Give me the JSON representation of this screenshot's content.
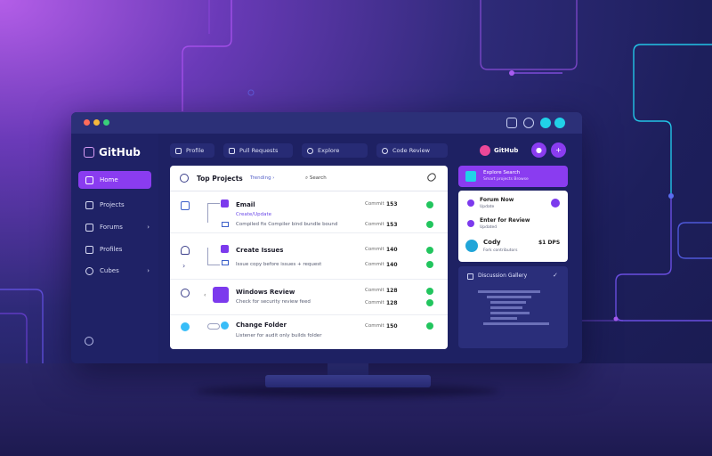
{
  "app": {
    "brand": "GitHub",
    "window_controls": [
      "#ff5f57",
      "#febc2e",
      "#28c840"
    ],
    "titlebar_icons": [
      "grid-icon",
      "clock-icon",
      "cloud-icon"
    ]
  },
  "sidebar": {
    "items": [
      {
        "label": "Home",
        "icon": "phone-icon",
        "active": true
      },
      {
        "label": "Projects",
        "icon": "folder-icon",
        "active": false
      },
      {
        "label": "Forums",
        "icon": "document-icon",
        "active": false,
        "chevron": "›"
      },
      {
        "label": "Profiles",
        "icon": "user-icon",
        "active": false
      },
      {
        "label": "Cubes",
        "icon": "cube-icon",
        "active": false,
        "chevron": "›"
      }
    ],
    "settings_icon": "gear-icon"
  },
  "topbar": {
    "pills": [
      "Profile",
      "Pull Requests",
      "Explore",
      "Code Review"
    ],
    "user_label": "GitHub",
    "user_btn_icons": [
      "bell-icon",
      "plus-icon"
    ]
  },
  "main": {
    "header": {
      "title": "Top Projects",
      "filter": "Trending",
      "search": "Search"
    },
    "rows": [
      {
        "title": "Email",
        "link": "Create/Update",
        "sub": "Compiled fix Compiler bind bundle bound",
        "stat": "Commit",
        "num": "153",
        "lead": "box-icon"
      },
      {
        "title": "Create Issues",
        "link": "",
        "sub": "Issue copy before issues + request",
        "stat": "Commit",
        "num": "140",
        "lead": "person-icon"
      },
      {
        "title": "Windows Review",
        "link": "",
        "sub": "Check for security review feed",
        "stat": "Commit",
        "num": "128",
        "lead": "timer-icon"
      },
      {
        "title": "Change Folder",
        "link": "",
        "sub": "Listener for audit only builds folder",
        "stat": "Commit",
        "num": "150",
        "lead": "globe-icon"
      }
    ]
  },
  "right": {
    "panel_a": {
      "title": "Explore Search",
      "sub": "Smart projects Browse"
    },
    "panel_b": [
      {
        "title": "Forum Now",
        "sub": "Update"
      },
      {
        "title": "Enter for Review",
        "sub": "Updated"
      },
      {
        "title": "Cody",
        "sub": "Fork contributors",
        "value": "$1 DPS"
      }
    ],
    "panel_c": {
      "title": "Discussion Gallery",
      "check": "✓"
    }
  }
}
